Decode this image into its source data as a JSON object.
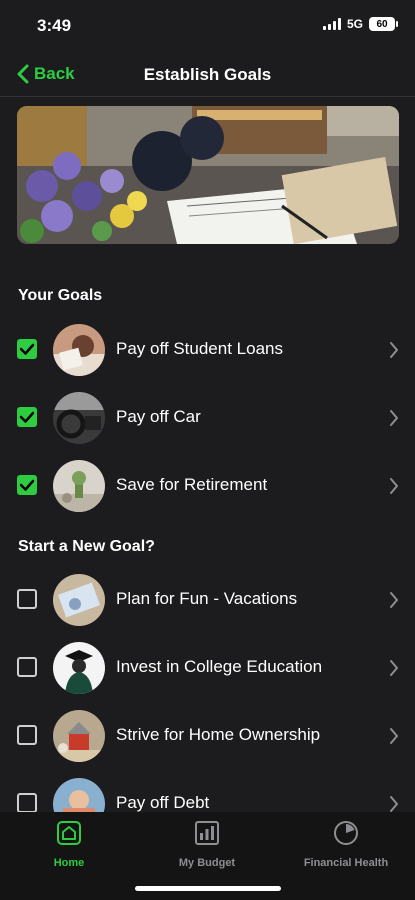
{
  "status_bar": {
    "time": "3:49",
    "network": "5G",
    "battery": "60"
  },
  "nav": {
    "back_label": "Back",
    "title": "Establish Goals"
  },
  "sections": {
    "your_goals": "Your Goals",
    "new_goal": "Start a New Goal?"
  },
  "your_goals": [
    {
      "label": "Pay off Student Loans",
      "checked": true,
      "icon": "student-loans-photo"
    },
    {
      "label": "Pay off Car",
      "checked": true,
      "icon": "car-interior-photo"
    },
    {
      "label": "Save for Retirement",
      "checked": true,
      "icon": "retirement-photo"
    }
  ],
  "new_goals": [
    {
      "label": "Plan for Fun - Vacations",
      "checked": false,
      "icon": "vacation-photo"
    },
    {
      "label": "Invest in College Education",
      "checked": false,
      "icon": "graduation-photo"
    },
    {
      "label": "Strive for Home Ownership",
      "checked": false,
      "icon": "house-photo"
    },
    {
      "label": "Pay off Debt",
      "checked": false,
      "icon": "debt-photo"
    }
  ],
  "tabs": [
    {
      "label": "Home",
      "icon": "home-icon",
      "active": true
    },
    {
      "label": "My Budget",
      "icon": "budget-icon",
      "active": false
    },
    {
      "label": "Financial Health",
      "icon": "financial-health-icon",
      "active": false
    }
  ],
  "colors": {
    "accent": "#2ecc40",
    "background": "#1c1c1e",
    "tab_inactive": "#8e8e93"
  }
}
